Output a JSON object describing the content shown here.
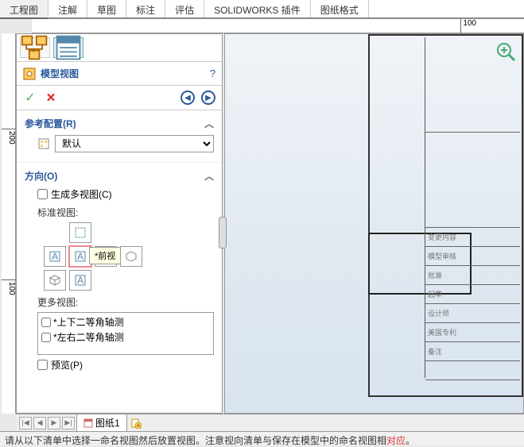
{
  "tabs": [
    "工程图",
    "注解",
    "草图",
    "标注",
    "评估",
    "SOLIDWORKS 插件",
    "图纸格式"
  ],
  "activeTab": 0,
  "ruler_h": "100",
  "ruler_v": {
    "top": "200",
    "bottom": "100"
  },
  "panel": {
    "title": "模型视图",
    "help": "?",
    "sections": {
      "config": {
        "title": "参考配置(R)",
        "default": "默认"
      },
      "orientation": {
        "title": "方向(O)",
        "multi": "生成多视图(C)",
        "std": "标准视图:",
        "tooltip": "*前视",
        "more": "更多视图:",
        "list": [
          "*上下二等角轴测",
          "*左右二等角轴测"
        ],
        "preview": "预览(P)"
      }
    }
  },
  "canvas": {
    "tb_rows": [
      "",
      "",
      "",
      "",
      "变更内容",
      "模型审核",
      "批准",
      "起草",
      "设计师",
      "美国专利",
      "备注",
      ""
    ]
  },
  "bottom": {
    "sheet": "图纸1"
  },
  "status": {
    "pre": "请从以下清单中选择一命名视图然后放置视图。注意视向清单与保存在模型中的命名视图相",
    "hl": "对应",
    "post": "。"
  }
}
